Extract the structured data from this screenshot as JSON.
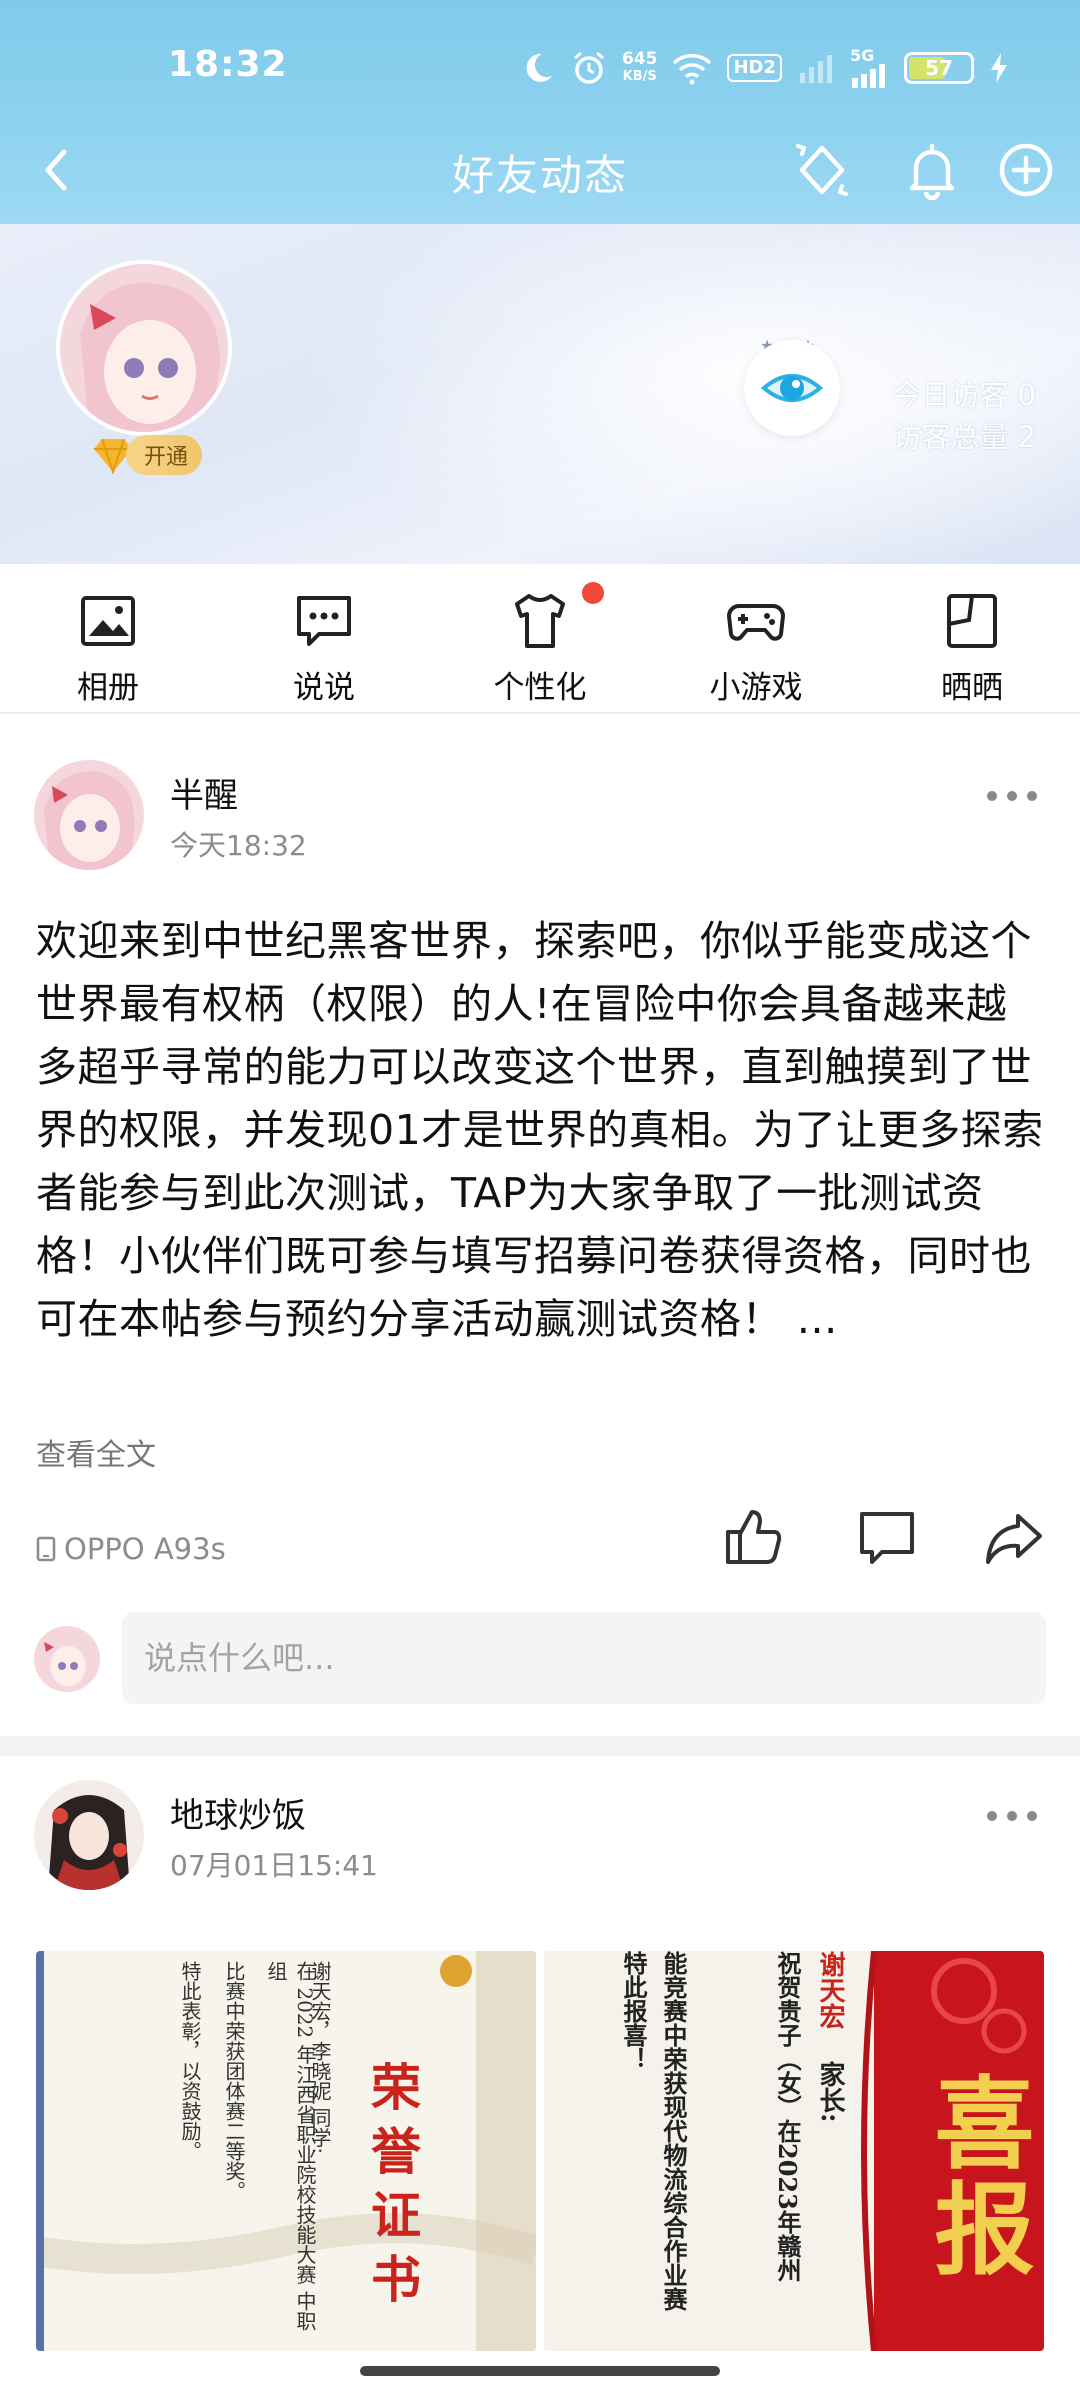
{
  "status_bar": {
    "time": "18:32",
    "net_speed_value": "645",
    "net_speed_unit": "KB/S",
    "hd_label": "HD2",
    "network_label": "5G",
    "battery_level": "57"
  },
  "titlebar": {
    "title": "好友动态"
  },
  "profile": {
    "vip_label": "开通",
    "visitors_today": "今日访客 0",
    "visitors_total": "访客总量 2"
  },
  "nav": {
    "items": [
      {
        "label": "相册"
      },
      {
        "label": "说说"
      },
      {
        "label": "个性化"
      },
      {
        "label": "小游戏"
      },
      {
        "label": "晒晒"
      }
    ]
  },
  "posts": [
    {
      "author": "半醒",
      "time": "今天18:32",
      "text": "欢迎来到中世纪黑客世界，探索吧，你似乎能变成这个世界最有权柄（权限）的人!在冒险中你会具备越来越多超乎寻常的能力可以改变这个世界，直到触摸到了世界的权限，并发现01才是世界的真相。为了让更多探索者能参与到此次测试，TAP为大家争取了一批测试资格！小伙伴们既可参与填写招募问卷获得资格，同时也可在本帖参与预约分享活动赢测试资格！ …",
      "read_more": "查看全文",
      "device": "OPPO A93s",
      "comment_placeholder": "说点什么吧..."
    },
    {
      "author": "地球炒饭",
      "time": "07月01日15:41",
      "photo1_texts": {
        "certificate_title": "荣誉证书",
        "line1": "在 2022 年江西省职业院校技能大赛 中职组",
        "line2": "比赛中荣获团体赛二等奖。",
        "line3": "特此表彰，以资鼓励。",
        "line4": "谢天宏，李晓妮 同学:"
      },
      "photo2_texts": {
        "headline": "喜报",
        "line1": "谢天宏",
        "line2": "家长:",
        "line3": "祝贺贵子（女）在2023年赣州",
        "line4": "能竞赛中荣获现代物流综合作业赛",
        "line5": "特此报喜！"
      }
    }
  ],
  "colors": {
    "header_blue": "#8fd3f0",
    "accent_red": "#f0473a",
    "text_gray": "#8c8c8c"
  }
}
